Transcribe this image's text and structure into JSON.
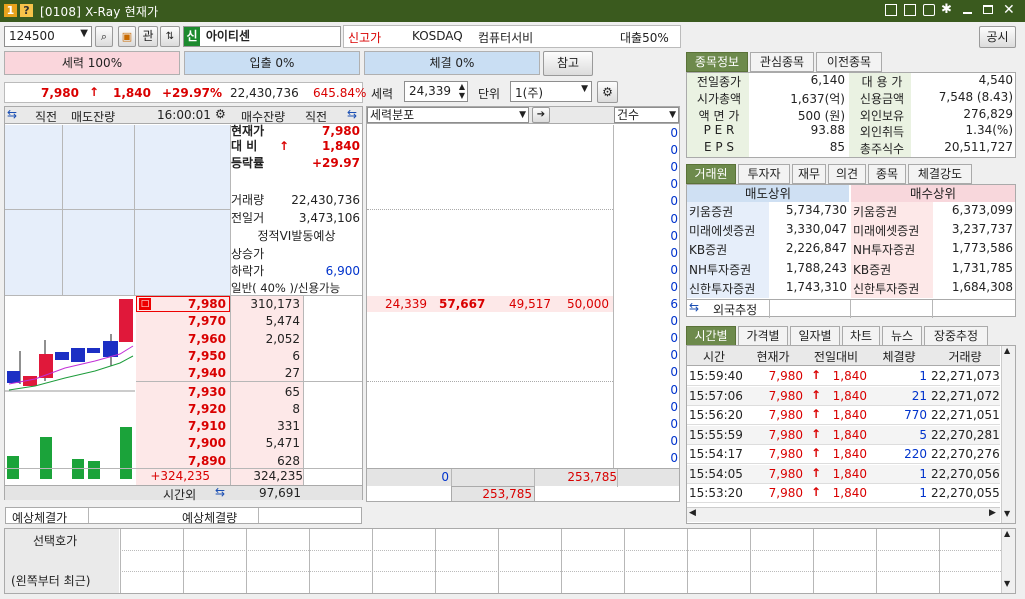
{
  "window": {
    "badge": "1",
    "question_badge": "?",
    "title": "[0108] X-Ray 현재가"
  },
  "toolbar": {
    "code": "124500",
    "btn_kwan": "관",
    "sin": "신",
    "stock_name": "아이티센",
    "news": "신고가",
    "market": "KOSDAQ",
    "sector": "컴퓨터서비",
    "loan": "대출50%",
    "gongsi": "공시"
  },
  "bars": {
    "force": "세력 100%",
    "inout": "입출 0%",
    "fill": "체결 0%",
    "ref": "참고"
  },
  "quote_line": {
    "price": "7,980",
    "arrow": "↑",
    "change": "1,840",
    "rate": "+29.97%",
    "volume": "22,430,736",
    "turnover": "645.84%"
  },
  "force_ctrl": {
    "label": "세력",
    "value": "24,339",
    "unit_label": "단위",
    "unit_value": "1(주)"
  },
  "orderbook": {
    "headers": {
      "prev": "직전",
      "ask_rem": "매도잔량",
      "time": "16:00:01",
      "bid_rem": "매수잔량",
      "prev2": "직전"
    },
    "info": [
      {
        "k": "현재가",
        "v": "7,980",
        "cls": "red"
      },
      {
        "k": "대  비",
        "v": "1,840",
        "cls": "red",
        "arrow": "↑"
      },
      {
        "k": "등락률",
        "v": "+29.97",
        "cls": "red"
      },
      {
        "k": "",
        "v": ""
      },
      {
        "k": "거래량",
        "v": "22,430,736"
      },
      {
        "k": "전일거",
        "v": "3,473,106"
      },
      {
        "k": "",
        "v": "정적VI발동예상",
        "center": true
      },
      {
        "k": "상승가",
        "v": ""
      },
      {
        "k": "하락가",
        "v": "6,900",
        "cls": "blue"
      },
      {
        "k": "일반( 40% )/신용가능",
        "v": ""
      }
    ],
    "prices": [
      {
        "p": "7,980",
        "q": "310,173",
        "cur": true
      },
      {
        "p": "7,970",
        "q": "5,474"
      },
      {
        "p": "7,960",
        "q": "2,052"
      },
      {
        "p": "7,950",
        "q": "6"
      },
      {
        "p": "7,940",
        "q": "27"
      },
      {
        "p": "7,930",
        "q": "65"
      },
      {
        "p": "7,920",
        "q": "8"
      },
      {
        "p": "7,910",
        "q": "331"
      },
      {
        "p": "7,900",
        "q": "5,471"
      },
      {
        "p": "7,890",
        "q": "628"
      }
    ],
    "total_left": "+324,235",
    "total_right": "324,235",
    "after_label": "시간외",
    "after_value": "97,691",
    "cur_badge": "□"
  },
  "expected": {
    "result": "예상체결가",
    "volume": "예상체결량"
  },
  "force_dist": {
    "header": "세력분포",
    "count_header": "건수",
    "counts": [
      "0",
      "0",
      "0",
      "0",
      "0",
      "0",
      "0",
      "0",
      "0",
      "0",
      "6",
      "0",
      "0",
      "0",
      "0",
      "0",
      "0",
      "0",
      "0",
      "0"
    ],
    "row": [
      "24,339",
      "57,667",
      "49,517",
      "50,000"
    ],
    "sum1": "0",
    "sum2": "253,785",
    "sum3": "253,785"
  },
  "right_tabs": [
    "종목정보",
    "관심종목",
    "이전종목"
  ],
  "stock_info": [
    {
      "k": "전일종가",
      "v": "6,140",
      "k2": "대 용 가",
      "v2": "4,540"
    },
    {
      "k": "시가총액",
      "v": "1,637(억)",
      "k2": "신용금액",
      "v2": "7,548  (8.43)"
    },
    {
      "k": "액 면 가",
      "v": "500 (원)",
      "k2": "외인보유",
      "v2": "276,829"
    },
    {
      "k": "P E R",
      "v": "93.88",
      "k2": "외인취득",
      "v2": "1.34(%)"
    },
    {
      "k": "E P S",
      "v": "85",
      "k2": "총주식수",
      "v2": "20,511,727"
    }
  ],
  "broker_tabs": [
    "거래원",
    "투자자",
    "재무",
    "의견",
    "종목",
    "체결강도"
  ],
  "brokers": {
    "sell_h": "매도상위",
    "buy_h": "매수상위",
    "rows": [
      {
        "s": "키움증권",
        "sv": "5,734,730",
        "b": "키움증권",
        "bv": "6,373,099"
      },
      {
        "s": "미래에셋증권",
        "sv": "3,330,047",
        "b": "미래에셋증권",
        "bv": "3,237,737"
      },
      {
        "s": "KB증권",
        "sv": "2,226,847",
        "b": "NH투자증권",
        "bv": "1,773,586"
      },
      {
        "s": "NH투자증권",
        "sv": "1,788,243",
        "b": "KB증권",
        "bv": "1,731,785"
      },
      {
        "s": "신한투자증권",
        "sv": "1,743,310",
        "b": "신한투자증권",
        "bv": "1,684,308"
      }
    ],
    "foreign": "외국추정"
  },
  "time_tabs": [
    "시간별",
    "가격별",
    "일자별",
    "차트",
    "뉴스",
    "장중추정"
  ],
  "ticks": {
    "headers": [
      "시간",
      "현재가",
      "전일대비",
      "체결량",
      "거래량"
    ],
    "rows": [
      [
        "15:59:40",
        "7,980",
        "1,840",
        "1",
        "22,271,073"
      ],
      [
        "15:57:06",
        "7,980",
        "1,840",
        "21",
        "22,271,072"
      ],
      [
        "15:56:20",
        "7,980",
        "1,840",
        "770",
        "22,271,051"
      ],
      [
        "15:55:59",
        "7,980",
        "1,840",
        "5",
        "22,270,281"
      ],
      [
        "15:54:17",
        "7,980",
        "1,840",
        "220",
        "22,270,276"
      ],
      [
        "15:54:05",
        "7,980",
        "1,840",
        "1",
        "22,270,056"
      ],
      [
        "15:53:20",
        "7,980",
        "1,840",
        "1",
        "22,270,055"
      ]
    ]
  },
  "bottom": {
    "l1": "선택호가",
    "l2": "(왼쪽부터 최근)"
  },
  "colors": {
    "title": "#3a5a1e",
    "tab_on": "#6d8a4c",
    "up": "#d90000",
    "down": "#0033cc"
  }
}
